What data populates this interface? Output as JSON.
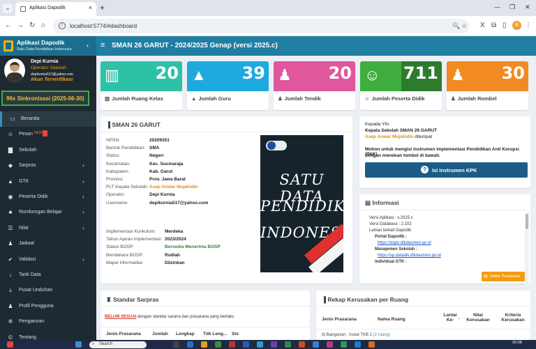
{
  "browser": {
    "tab_title": "Aplikasi Dapodik",
    "url": "localhost:5774/#dashboard"
  },
  "app": {
    "title": "Aplikasi Dapodik",
    "subtitle": "Satu Data Pendidikan Indonesia",
    "header_title": "SMAN 26 GARUT - 2024/2025 Genap (versi 2025.c)"
  },
  "user": {
    "name": "Depi Kurnia",
    "role": "Operator Sekolah",
    "email": "depikurnia517@yahoo.com",
    "status": "Akun Terverifikasi",
    "sync": "96x Sinkronisasi (2025-06-30)"
  },
  "menu": [
    {
      "label": "Beranda",
      "icon": "monitor-icon",
      "arrow": false
    },
    {
      "label": "Pesan",
      "icon": "chat-icon",
      "arrow": false,
      "badge": "NEW"
    },
    {
      "label": "Sekolah",
      "icon": "building-icon",
      "arrow": false
    },
    {
      "label": "Sarpras",
      "icon": "cubes-icon",
      "arrow": true
    },
    {
      "label": "GTK",
      "icon": "graduation-cap-icon",
      "arrow": true
    },
    {
      "label": "Peserta Didik",
      "icon": "user-circle-icon",
      "arrow": true
    },
    {
      "label": "Rombongan Belajar",
      "icon": "group-icon",
      "arrow": true
    },
    {
      "label": "Nilai",
      "icon": "list-icon",
      "arrow": true
    },
    {
      "label": "Jadwal",
      "icon": "users-icon",
      "arrow": false
    },
    {
      "label": "Validasi",
      "icon": "check-icon",
      "arrow": true
    },
    {
      "label": "Tarik Data",
      "icon": "arrow-down-icon",
      "arrow": false
    },
    {
      "label": "Pusat Unduhan",
      "icon": "download-icon",
      "arrow": false
    },
    {
      "label": "Profil Pengguna",
      "icon": "user-icon",
      "arrow": false
    },
    {
      "label": "Pengaturan",
      "icon": "cogs-icon",
      "arrow": false
    },
    {
      "label": "Tentang",
      "icon": "copyright-icon",
      "arrow": false
    }
  ],
  "stats": [
    {
      "value": "20",
      "label": "Jumlah Ruang Kelas",
      "icon": "bank-icon",
      "color": "#2fc1a8"
    },
    {
      "value": "39",
      "label": "Jumlah Guru",
      "icon": "graduation-cap-icon",
      "color": "#1ea9df"
    },
    {
      "value": "20",
      "label": "Jumlah Tendik",
      "icon": "user-icon",
      "color": "#e0579e"
    },
    {
      "value": "711",
      "label": "Jumlah Peserta Didik",
      "icon": "smile-icon",
      "color": "#3fae3f"
    },
    {
      "value": "30",
      "label": "Jumlah Rombel",
      "icon": "users-icon",
      "color": "#f28a22"
    }
  ],
  "school": {
    "title": "SMAN 26 GARUT",
    "fields": [
      {
        "k": "NPSN:",
        "v": "20209351"
      },
      {
        "k": "Bentuk Pendidikan:",
        "v": "SMA"
      },
      {
        "k": "Status:",
        "v": "Negeri"
      },
      {
        "k": "Kecamatan:",
        "v": "Kec. Sucinaraja"
      },
      {
        "k": "Kabupaten:",
        "v": "Kab. Garut"
      },
      {
        "k": "Provinsi:",
        "v": "Prov. Jawa Barat"
      },
      {
        "k": "PLT Kepala Sekolah:",
        "v": "Asep Anwar Mujahidin"
      },
      {
        "k": "Operator:",
        "v": "Depi Kurnia"
      },
      {
        "k": "Username:",
        "v": "depikurnia517@yahoo.com"
      }
    ],
    "fields2": [
      {
        "k": "Implementasi Kurikulum:",
        "v": "Merdeka"
      },
      {
        "k": "Tahun Ajaran Implementasi:",
        "v": "2023/2024"
      },
      {
        "k": "Status BOSP:",
        "v": "Bersedia Menerima BOSP"
      },
      {
        "k": "Bendahara BOSP:",
        "v": "Rodiah"
      },
      {
        "k": "Mapel Informatika:",
        "v": "Diizinkan"
      }
    ],
    "poster_lines": [
      "SATU DATA",
      "PENDIDIKAN",
      "INDONESIA"
    ]
  },
  "notice": {
    "line1": "Kepada Yth.",
    "line2": "Kepala Sekolah SMAN 26 GARUT",
    "line3_name": "Asep Anwar Mujahidin",
    "line3_rest": "ditempat",
    "line4": "Mohon untuk mengisi instrumen implementasi Pendidikan Anti Korupsi (PAK)",
    "line5": "dengan menekan tombol di bawah.",
    "button": "Isi Instrumen KPK"
  },
  "info": {
    "title": "Informasi",
    "items": [
      "Versi Aplikasi : v.2025.c",
      "Versi Database : 2.102",
      "Laman terkait Dapodik:",
      "Portal Dapodik :",
      "https://dapo.dikdasmen.go.id",
      "Manajemen Sekolah :",
      "https://sp.datadik.dikdasmen.go.id",
      "Individual GTK :"
    ],
    "button": "Daftar Perubahan"
  },
  "sarpras": {
    "title": "Standar Sarpras",
    "status": "BELUM SESUAI",
    "status_rest": "dengan standar sarana dan prasarana yang berlaku",
    "headers": [
      "Jenis Prasarana",
      "Jumlah",
      "Lengkap",
      "Tdk Leng...",
      "Sts"
    ]
  },
  "rekap": {
    "title": "Rekap Kerusakan per Ruang",
    "headers": [
      "Jenis Prasarana",
      "Nama Ruang",
      "Lantai Ke-",
      "Nilai Kerusakan",
      "Kriteria Kerusakan"
    ],
    "group": "Bangunan : Aseal TKB 2",
    "group_count": "(2 ruang)"
  },
  "taskbar": {
    "search": "Search",
    "time": "20.08"
  }
}
